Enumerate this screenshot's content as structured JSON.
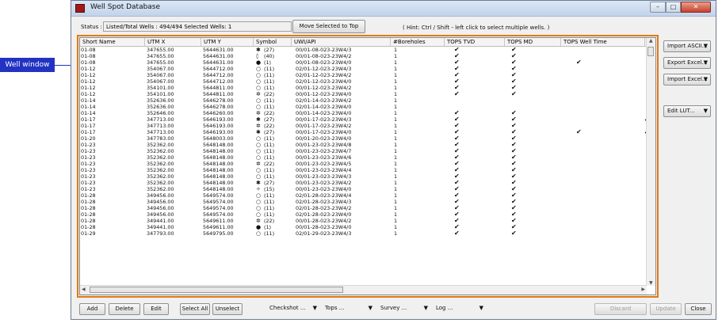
{
  "callout": {
    "label": "Well window"
  },
  "window": {
    "title": "Well Spot Database",
    "controls": {
      "minimize": "–",
      "maximize": "□",
      "close": "✕"
    }
  },
  "status": {
    "label": "Status :",
    "value": "Listed/Total Wells : 494/494 Selected Wells: 1",
    "move_button": "Move Selected to Top",
    "hint": "( Hint: Ctrl / Shift - left click to select multiple wells. )"
  },
  "table": {
    "columns": [
      "Short Name",
      "UTM X",
      "UTM Y",
      "Symbol",
      "UWI/API",
      "#Boreholes",
      "TOPS TVD",
      "TOPS MD",
      "TOPS Well Time",
      "T"
    ],
    "rows": [
      [
        "01-08",
        "347655.00",
        "5644631.00",
        "✱",
        "(27)",
        "00/01-08-023-23W4/3",
        "1",
        "✔",
        "✔",
        ""
      ],
      [
        "01-08",
        "347655.00",
        "5644631.00",
        "◊",
        "(40)",
        "00/01-08-023-23W4/2",
        "1",
        "✔",
        "✔",
        ""
      ],
      [
        "01-08",
        "347655.00",
        "5644631.00",
        "●",
        "(1)",
        "00/01-08-023-23W4/0",
        "1",
        "✔",
        "✔",
        "✔"
      ],
      [
        "01-12",
        "354067.00",
        "5644712.00",
        "○",
        "(11)",
        "02/01-12-023-23W4/3",
        "1",
        "✔",
        "✔",
        ""
      ],
      [
        "01-12",
        "354067.00",
        "5644712.00",
        "○",
        "(11)",
        "02/01-12-023-23W4/2",
        "1",
        "✔",
        "✔",
        ""
      ],
      [
        "01-12",
        "354067.00",
        "5644712.00",
        "○",
        "(11)",
        "02/01-12-023-23W4/0",
        "1",
        "✔",
        "✔",
        ""
      ],
      [
        "01-12",
        "354101.00",
        "5644811.00",
        "○",
        "(11)",
        "00/01-12-023-23W4/2",
        "1",
        "✔",
        "✔",
        ""
      ],
      [
        "01-12",
        "354101.00",
        "5644811.00",
        "✲",
        "(22)",
        "00/01-12-023-23W4/0",
        "1",
        "✔",
        "✔",
        ""
      ],
      [
        "01-14",
        "352636.00",
        "5646278.00",
        "○",
        "(11)",
        "02/01-14-023-23W4/2",
        "1",
        "",
        "",
        ""
      ],
      [
        "01-14",
        "352636.00",
        "5646278.00",
        "○",
        "(11)",
        "02/01-14-023-23W4/0",
        "1",
        "",
        "",
        ""
      ],
      [
        "01-14",
        "352646.00",
        "5646260.00",
        "✲",
        "(22)",
        "00/01-14-023-23W4/0",
        "1",
        "✔",
        "✔",
        ""
      ],
      [
        "01-17",
        "347713.00",
        "5646193.00",
        "✱",
        "(27)",
        "00/01-17-023-23W4/3",
        "1",
        "✔",
        "✔",
        ""
      ],
      [
        "01-17",
        "347713.00",
        "5646193.00",
        "✲",
        "(22)",
        "00/01-17-023-23W4/2",
        "1",
        "✔",
        "✔",
        ""
      ],
      [
        "01-17",
        "347713.00",
        "5646193.00",
        "✱",
        "(27)",
        "00/01-17-023-23W4/0",
        "1",
        "✔",
        "✔",
        "✔"
      ],
      [
        "01-20",
        "347783.00",
        "5648003.00",
        "○",
        "(11)",
        "00/01-20-023-23W4/0",
        "1",
        "✔",
        "✔",
        ""
      ],
      [
        "01-23",
        "352362.00",
        "5648148.00",
        "○",
        "(11)",
        "00/01-23-023-23W4/8",
        "1",
        "✔",
        "✔",
        ""
      ],
      [
        "01-23",
        "352362.00",
        "5648148.00",
        "○",
        "(11)",
        "00/01-23-023-23W4/7",
        "1",
        "✔",
        "✔",
        ""
      ],
      [
        "01-23",
        "352362.00",
        "5648148.00",
        "○",
        "(11)",
        "00/01-23-023-23W4/6",
        "1",
        "✔",
        "✔",
        ""
      ],
      [
        "01-23",
        "352362.00",
        "5648148.00",
        "✲",
        "(22)",
        "00/01-23-023-23W4/5",
        "1",
        "✔",
        "✔",
        ""
      ],
      [
        "01-23",
        "352362.00",
        "5648148.00",
        "○",
        "(11)",
        "00/01-23-023-23W4/4",
        "1",
        "✔",
        "✔",
        ""
      ],
      [
        "01-23",
        "352362.00",
        "5648148.00",
        "○",
        "(11)",
        "00/01-23-023-23W4/3",
        "1",
        "✔",
        "✔",
        ""
      ],
      [
        "01-23",
        "352362.00",
        "5648148.00",
        "✱",
        "(27)",
        "00/01-23-023-23W4/2",
        "1",
        "✔",
        "✔",
        ""
      ],
      [
        "01-23",
        "352362.00",
        "5648148.00",
        "✧",
        "(15)",
        "00/01-23-023-23W4/0",
        "1",
        "✔",
        "✔",
        ""
      ],
      [
        "01-28",
        "349456.00",
        "5649574.00",
        "○",
        "(11)",
        "02/01-28-023-23W4/4",
        "1",
        "✔",
        "✔",
        ""
      ],
      [
        "01-28",
        "349456.00",
        "5649574.00",
        "○",
        "(11)",
        "02/01-28-023-23W4/3",
        "1",
        "✔",
        "✔",
        ""
      ],
      [
        "01-28",
        "349456.00",
        "5649574.00",
        "○",
        "(11)",
        "02/01-28-023-23W4/2",
        "1",
        "✔",
        "✔",
        ""
      ],
      [
        "01-28",
        "349456.00",
        "5649574.00",
        "○",
        "(11)",
        "02/01-28-023-23W4/0",
        "1",
        "✔",
        "✔",
        ""
      ],
      [
        "01-28",
        "349441.00",
        "5649611.00",
        "✲",
        "(22)",
        "00/01-28-023-23W4/2",
        "1",
        "✔",
        "✔",
        ""
      ],
      [
        "01-28",
        "349441.00",
        "5649611.00",
        "●",
        "(1)",
        "00/01-28-023-23W4/0",
        "1",
        "✔",
        "✔",
        ""
      ],
      [
        "01-29",
        "347793.00",
        "5649795.00",
        "○",
        "(11)",
        "02/01-29-023-23W4/3",
        "1",
        "✔",
        "✔",
        ""
      ]
    ],
    "partial_last_column_marks": [
      "",
      "",
      "",
      "",
      "",
      "",
      "",
      "",
      "",
      "",
      "",
      "✔",
      "",
      "✔",
      "",
      "",
      "",
      "",
      "",
      "",
      "",
      "",
      "",
      "",
      "",
      "",
      "",
      "",
      "",
      ""
    ]
  },
  "right_buttons": [
    "Import ASCII...",
    "Export Excel...",
    "Import Excel...",
    "Edit LUT..."
  ],
  "bottom": {
    "add": "Add",
    "delete": "Delete",
    "edit": "Edit",
    "select_all": "Select All",
    "unselect": "Unselect",
    "checkshot": "Checkshot ...",
    "tops": "Tops ...",
    "survey": "Survey ...",
    "log": "Log ...",
    "discard": "Discard",
    "update": "Update",
    "close": "Close"
  }
}
